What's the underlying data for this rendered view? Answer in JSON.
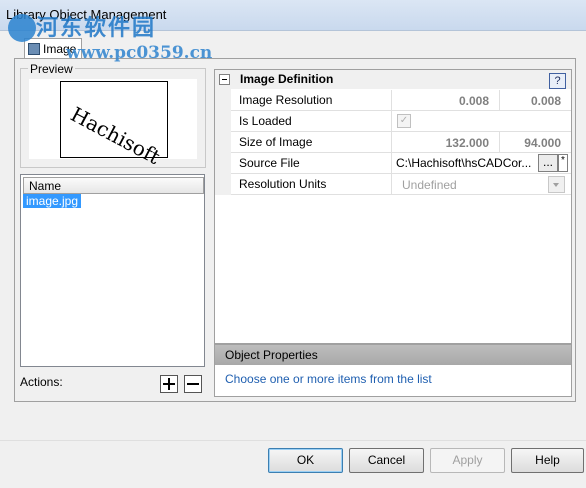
{
  "window": {
    "title": "Library Object Management"
  },
  "watermark": {
    "text_cn": "河东软件园",
    "url": "www.pc0359.cn"
  },
  "tab": {
    "label": "Image"
  },
  "preview": {
    "group_label": "Preview",
    "image_text": "Hachisoft"
  },
  "list": {
    "column_header": "Name",
    "items": [
      "image.jpg"
    ]
  },
  "actions": {
    "label": "Actions:",
    "add_icon": "plus-icon",
    "remove_icon": "minus-icon"
  },
  "properties": {
    "category": "Image Definition",
    "help_label": "?",
    "rows": [
      {
        "name": "Image Resolution",
        "value1": "0.008",
        "value2": "0.008"
      },
      {
        "name": "Is Loaded",
        "checked": true,
        "check_mark": "✓"
      },
      {
        "name": "Size of Image",
        "value1": "132.000",
        "value2": "94.000"
      },
      {
        "name": "Source File",
        "value": "C:\\Hachisoft\\hsCADCor...",
        "browse_label": "...",
        "star_label": "*"
      },
      {
        "name": "Resolution Units",
        "value": "Undefined"
      }
    ]
  },
  "object_properties": {
    "title": "Object Properties",
    "description": "Choose one or more items from the list"
  },
  "buttons": {
    "ok": "OK",
    "cancel": "Cancel",
    "apply": "Apply",
    "help": "Help"
  }
}
